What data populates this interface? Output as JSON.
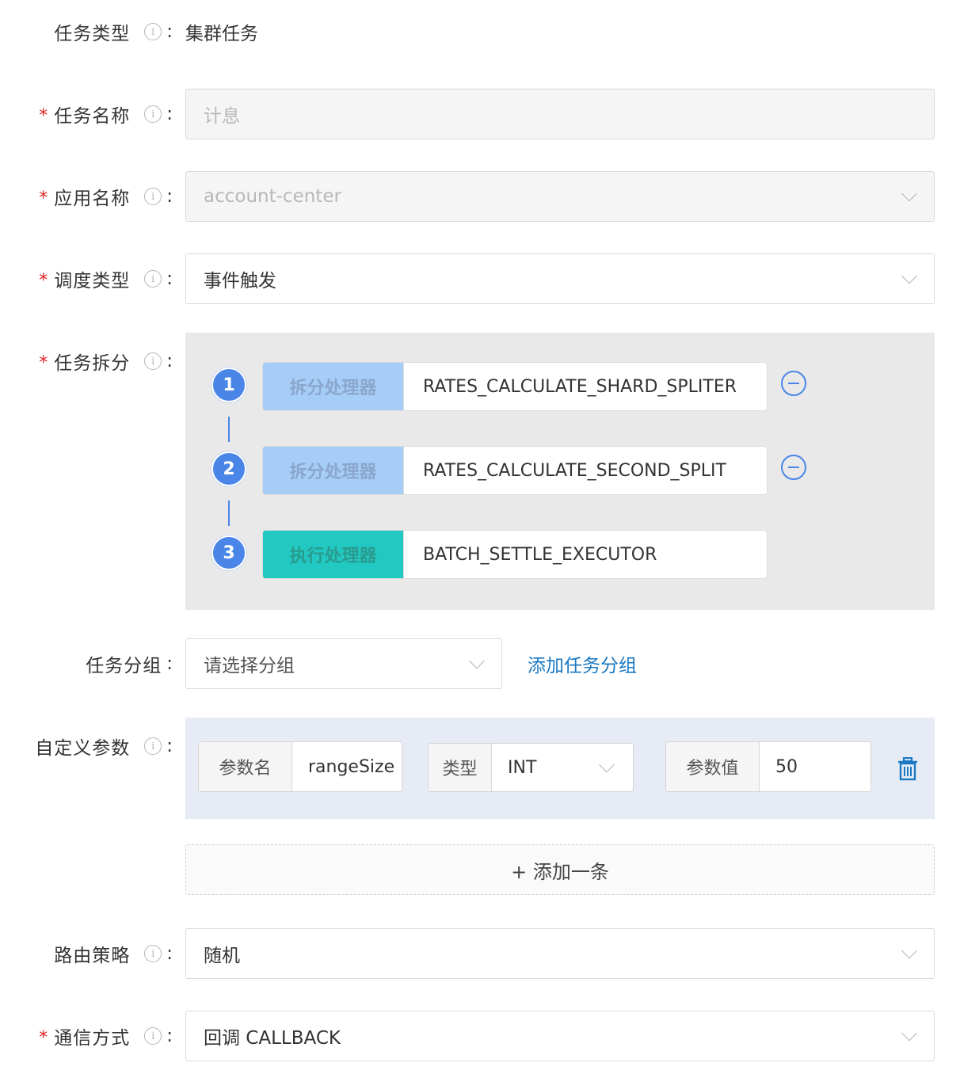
{
  "form": {
    "task_type": {
      "label": "任务类型",
      "colon": ":",
      "value": "集群任务"
    },
    "task_name": {
      "label": "任务名称",
      "required": "*",
      "colon": ":",
      "placeholder": "计息"
    },
    "app_name": {
      "label": "应用名称",
      "required": "*",
      "colon": ":",
      "value": "account-center"
    },
    "schedule_type": {
      "label": "调度类型",
      "required": "*",
      "colon": ":",
      "value": "事件触发"
    },
    "task_split": {
      "label": "任务拆分",
      "required": "*",
      "colon": ":",
      "steps": [
        {
          "number": "1",
          "tag": "拆分处理器",
          "value": "RATES_CALCULATE_SHARD_SPLITER",
          "removable": true
        },
        {
          "number": "2",
          "tag": "拆分处理器",
          "value": "RATES_CALCULATE_SECOND_SPLIT",
          "removable": true
        },
        {
          "number": "3",
          "tag": "执行处理器",
          "value": "BATCH_SETTLE_EXECUTOR",
          "removable": false
        }
      ]
    },
    "task_group": {
      "label": "任务分组",
      "colon": ":",
      "placeholder": "请选择分组",
      "add_link": "添加任务分组"
    },
    "custom_params": {
      "label": "自定义参数",
      "colon": ":",
      "items": [
        {
          "name_label": "参数名",
          "name_value": "rangeSize",
          "type_label": "类型",
          "type_value": "INT",
          "value_label": "参数值",
          "value": "50"
        }
      ],
      "add_button": "+ 添加一条"
    },
    "route_strategy": {
      "label": "路由策略",
      "colon": ":",
      "value": "随机"
    },
    "comm_mode": {
      "label": "通信方式",
      "required": "*",
      "colon": ":",
      "value": "回调 CALLBACK"
    }
  },
  "colors": {
    "accent": "#4a86e8",
    "required": "#e02020",
    "link": "#1a78c2",
    "split_tag": "#a6cdf7",
    "exec_tag": "#21c9c2",
    "split_panel_bg": "#e9e9e9",
    "param_panel_bg": "#e6ebf5"
  },
  "icons": [
    "info-icon",
    "chevron-down-icon",
    "minus-circle-icon",
    "trash-icon"
  ]
}
